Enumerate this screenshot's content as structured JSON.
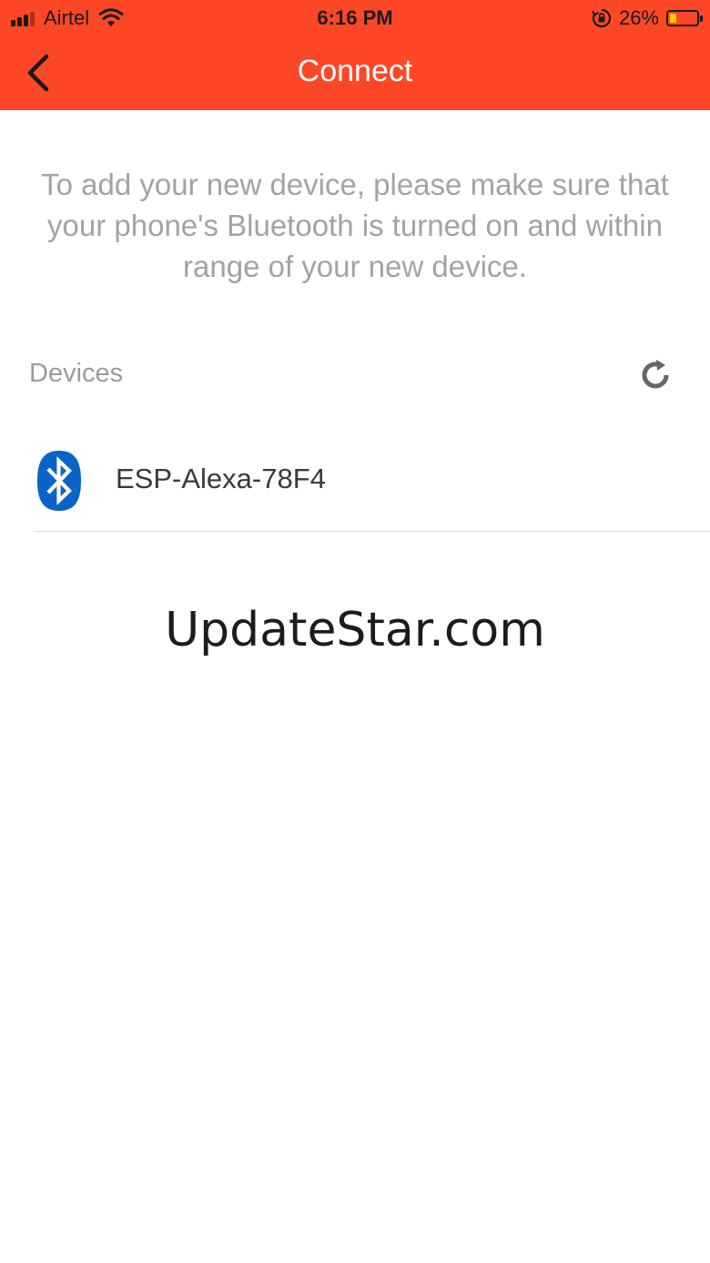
{
  "status_bar": {
    "carrier": "Airtel",
    "time": "6:16 PM",
    "battery_percent": "26%",
    "battery_level": 0.26,
    "signal_icon": "cellular-signal-icon",
    "wifi_icon": "wifi-icon",
    "rotation_lock_icon": "rotation-lock-icon"
  },
  "nav": {
    "title": "Connect",
    "back_icon": "chevron-left-icon"
  },
  "instructions": "To add your new device, please make sure that your phone's Bluetooth is turned on and within range of your new device.",
  "devices": {
    "label": "Devices",
    "refresh_icon": "refresh-icon",
    "items": [
      {
        "name": "ESP-Alexa-78F4",
        "icon": "bluetooth-icon"
      }
    ]
  },
  "watermark": "UpdateStar.com",
  "colors": {
    "brand": "#fd4726",
    "bluetooth": "#0a64c8",
    "muted_text": "#a3a3a3"
  }
}
